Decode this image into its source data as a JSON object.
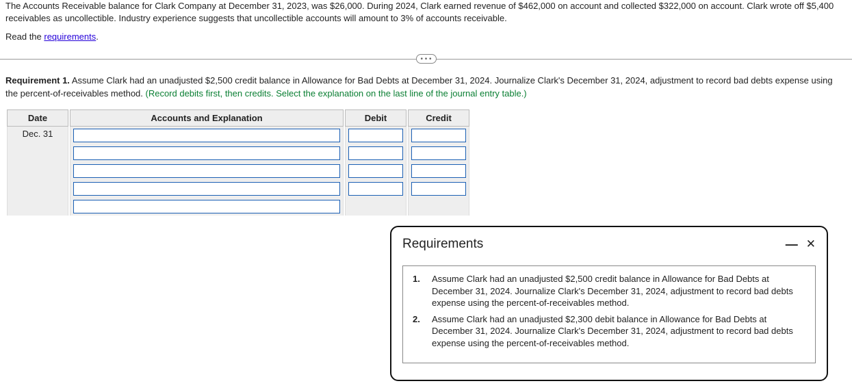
{
  "problem_text": "The Accounts Receivable balance for Clark Company at December 31, 2023, was $26,000. During 2024, Clark earned revenue of $462,000 on account and collected $322,000 on account. Clark wrote off $5,400 receivables as uncollectible. Industry experience suggests that uncollectible accounts will amount to 3% of accounts receivable.",
  "read_prefix": "Read the ",
  "read_link": "requirements",
  "read_suffix": ".",
  "divider_label": "• • •",
  "requirement1": {
    "label": "Requirement 1.",
    "text": " Assume Clark had an unadjusted $2,500 credit balance in Allowance for Bad Debts at December 31, 2024. Journalize Clark's December 31, 2024, adjustment to record bad debts expense using the percent-of-receivables method. ",
    "instruction": "(Record debits first, then credits. Select the explanation on the last line of the journal entry table.)"
  },
  "table": {
    "headers": {
      "date": "Date",
      "accounts": "Accounts and Explanation",
      "debit": "Debit",
      "credit": "Credit"
    },
    "date_value": "Dec. 31"
  },
  "modal": {
    "title": "Requirements",
    "items": [
      {
        "num": "1.",
        "text": "Assume Clark had an unadjusted $2,500 credit balance in Allowance for Bad Debts at December 31, 2024. Journalize Clark's December 31, 2024, adjustment to record bad debts expense using the percent-of-receivables method."
      },
      {
        "num": "2.",
        "text": "Assume Clark had an unadjusted $2,300 debit balance in Allowance for Bad Debts at December 31, 2024. Journalize Clark's December 31, 2024, adjustment to record bad debts expense using the percent-of-receivables method."
      }
    ]
  }
}
